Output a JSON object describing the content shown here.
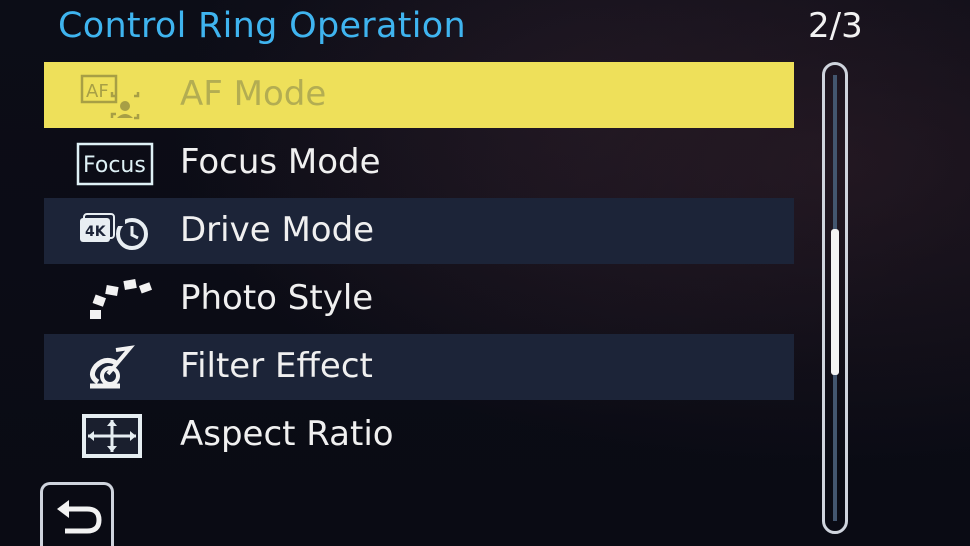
{
  "header": {
    "title": "Control Ring Operation",
    "page_indicator": "2/3"
  },
  "menu": {
    "items": [
      {
        "label": "AF Mode",
        "icon": "af-mode-icon",
        "state": "selected",
        "icon_text": "AF"
      },
      {
        "label": "Focus Mode",
        "icon": "focus-mode-icon",
        "state": "normal",
        "icon_text": "Focus"
      },
      {
        "label": "Drive Mode",
        "icon": "drive-mode-icon",
        "state": "normal",
        "icon_text": "4K"
      },
      {
        "label": "Photo Style",
        "icon": "photo-style-icon",
        "state": "normal"
      },
      {
        "label": "Filter Effect",
        "icon": "filter-effect-icon",
        "state": "normal"
      },
      {
        "label": "Aspect Ratio",
        "icon": "aspect-ratio-icon",
        "state": "normal"
      }
    ]
  },
  "scrollbar": {
    "current_page": 2,
    "total_pages": 3
  },
  "footer": {
    "back_icon": "return-arrow-icon"
  },
  "colors": {
    "title": "#3fb4ef",
    "selected_row": "#eee05a",
    "shaded_row": "#1c2438",
    "text": "#f0f0f0"
  }
}
